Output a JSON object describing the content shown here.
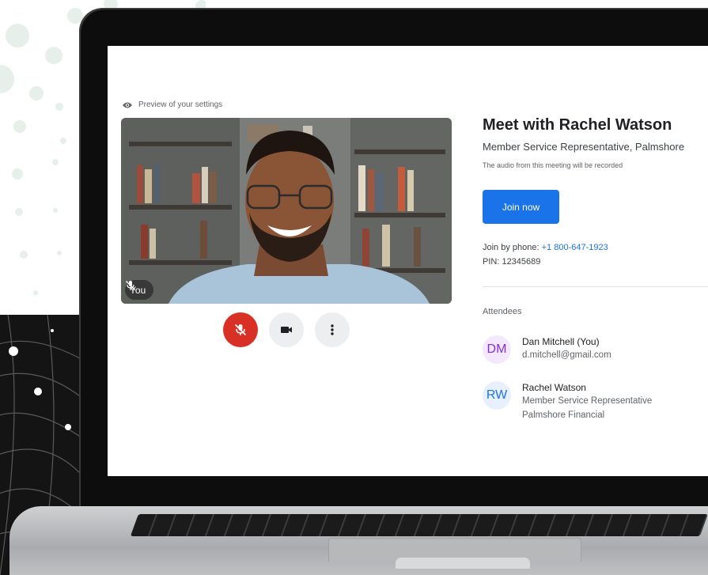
{
  "preview": {
    "label": "Preview of your settings",
    "self_label": "You"
  },
  "meeting": {
    "title": "Meet with Rachel Watson",
    "subtitle": "Member Service Representative, Palmshore",
    "recording_notice": "The audio from this meeting will be recorded",
    "join_label": "Join now",
    "phone_prefix": "Join by phone: ",
    "phone_number": "+1 800-647-1923",
    "pin": "PIN: 12345689"
  },
  "attendees": {
    "heading": "Attendees",
    "list": [
      {
        "initials": "DM",
        "name": "Dan Mitchell (You)",
        "line1": "d.mitchell@gmail.com",
        "line2": ""
      },
      {
        "initials": "RW",
        "name": "Rachel Watson",
        "line1": "Member Service Representative",
        "line2": "Palmshore Financial"
      }
    ]
  },
  "icons": {
    "preview": "eye-icon",
    "mic": "mic-off-icon",
    "camera": "video-camera-icon",
    "more": "more-vertical-icon"
  },
  "colors": {
    "primary": "#1a73e8",
    "mic_off": "#d93025",
    "dm_avatar": "#8430ce",
    "rw_avatar": "#1a73e8"
  }
}
